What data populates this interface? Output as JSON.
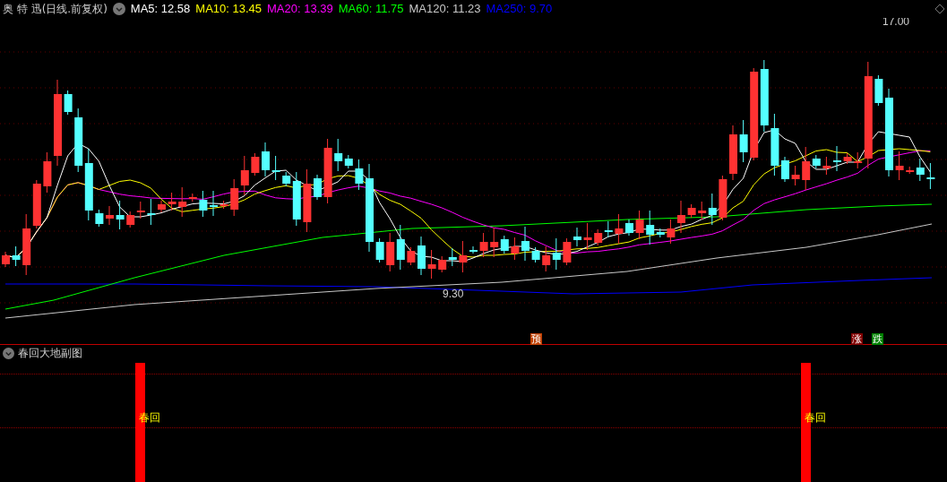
{
  "title": "奥 特 迅(日线.前复权)",
  "legend": [
    {
      "label": "MA5: 12.58",
      "color": "#ffffff"
    },
    {
      "label": "MA10: 13.45",
      "color": "#ffff00"
    },
    {
      "label": "MA20: 13.39",
      "color": "#ff00ff"
    },
    {
      "label": "MA60: 11.75",
      "color": "#00ff00"
    },
    {
      "label": "MA120: 11.23",
      "color": "#c8c8c8"
    },
    {
      "label": "MA250: 9.70",
      "color": "#0000ff"
    }
  ],
  "price_marks": [
    {
      "kind": "high",
      "text": "17.00"
    },
    {
      "kind": "low",
      "text": "9.30"
    }
  ],
  "event_markers": [
    {
      "text": "预",
      "color": "#c04000"
    },
    {
      "text": "涨",
      "color": "#800000"
    },
    {
      "text": "跌",
      "color": "#008000"
    }
  ],
  "subchart": {
    "title": "春回大地副图",
    "signals": [
      {
        "label": "春回"
      },
      {
        "label": "春回"
      }
    ]
  }
}
